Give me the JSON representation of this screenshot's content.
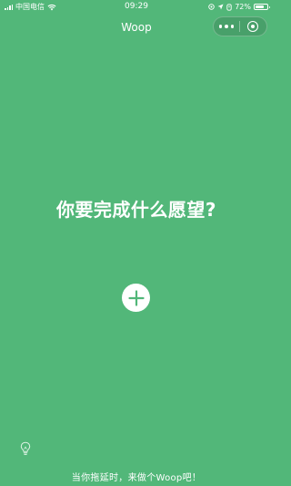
{
  "status_bar": {
    "carrier": "中国电信",
    "time": "09:29",
    "battery": "72%",
    "battery_level": 0.72,
    "icons": [
      "signal-icon",
      "wifi-icon",
      "location-icon",
      "alarm-icon",
      "battery-icon"
    ]
  },
  "nav": {
    "title": "Woop",
    "capsule_icons": [
      "more-icon",
      "close-miniprogram-icon"
    ]
  },
  "main": {
    "question": "你要完成什么愿望?",
    "add_icon": "plus-icon"
  },
  "footer": {
    "tip_icon": "lightbulb-icon",
    "text": "当你拖延时，来做个Woop吧！"
  },
  "colors": {
    "background": "#52b779",
    "foreground": "#ffffff",
    "add_icon": "#52b779"
  }
}
